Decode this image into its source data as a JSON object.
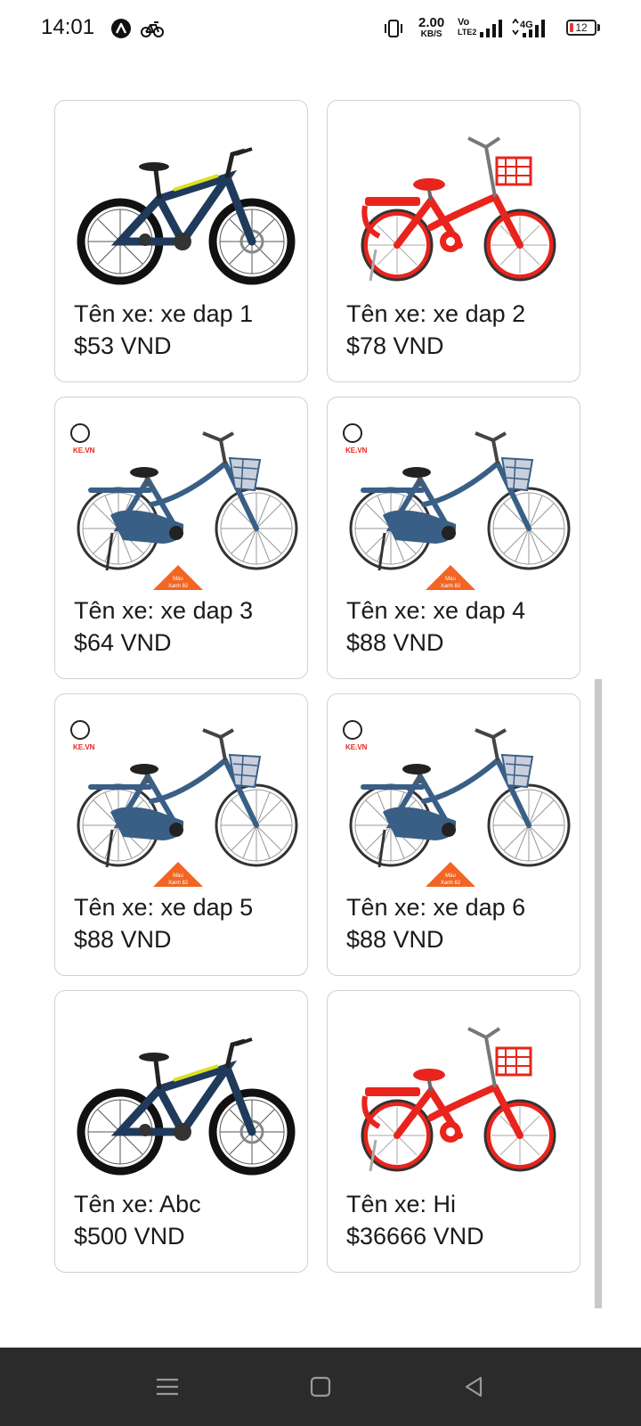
{
  "status_bar": {
    "time": "14:01",
    "net_speed_value": "2.00",
    "net_speed_unit": "KB/S",
    "volte_line1": "Vo",
    "volte_line2": "LTE2",
    "network_type": "4G",
    "battery": "12",
    "icons": [
      "assistant-icon",
      "bike-notification-icon",
      "vibrate-icon",
      "signal-icon",
      "signal-4g-icon",
      "battery-icon"
    ]
  },
  "products": [
    {
      "name": "Tên xe: xe dap 1",
      "price": "$53 VND",
      "image": "mountain-bike"
    },
    {
      "name": "Tên xe: xe dap 2",
      "price": "$78 VND",
      "image": "red-kids-bike"
    },
    {
      "name": "Tên xe: xe dap 3",
      "price": "$64 VND",
      "image": "blue-city-bike"
    },
    {
      "name": "Tên xe: xe dap 4",
      "price": "$88 VND",
      "image": "blue-city-bike"
    },
    {
      "name": "Tên xe: xe dap 5",
      "price": "$88 VND",
      "image": "blue-city-bike"
    },
    {
      "name": "Tên xe: xe dap 6",
      "price": "$88 VND",
      "image": "blue-city-bike"
    },
    {
      "name": "Tên xe: Abc",
      "price": "$500 VND",
      "image": "mountain-bike"
    },
    {
      "name": "Tên xe: Hi",
      "price": "$36666 VND",
      "image": "red-kids-bike"
    }
  ],
  "image_overlays": {
    "logo_text": "KE.VN",
    "badge_line1": "Màu",
    "badge_line2": "Xanh 82"
  },
  "nav_bar": {
    "buttons": [
      "menu-icon",
      "home-icon",
      "back-icon"
    ]
  },
  "colors": {
    "mountain_bike": "#1f3a5a",
    "mountain_accent": "#d9e021",
    "red_bike": "#e8241d",
    "blue_bike": "#3a5f86",
    "badge": "#f26522",
    "nav_bg": "#2b2b2b"
  }
}
